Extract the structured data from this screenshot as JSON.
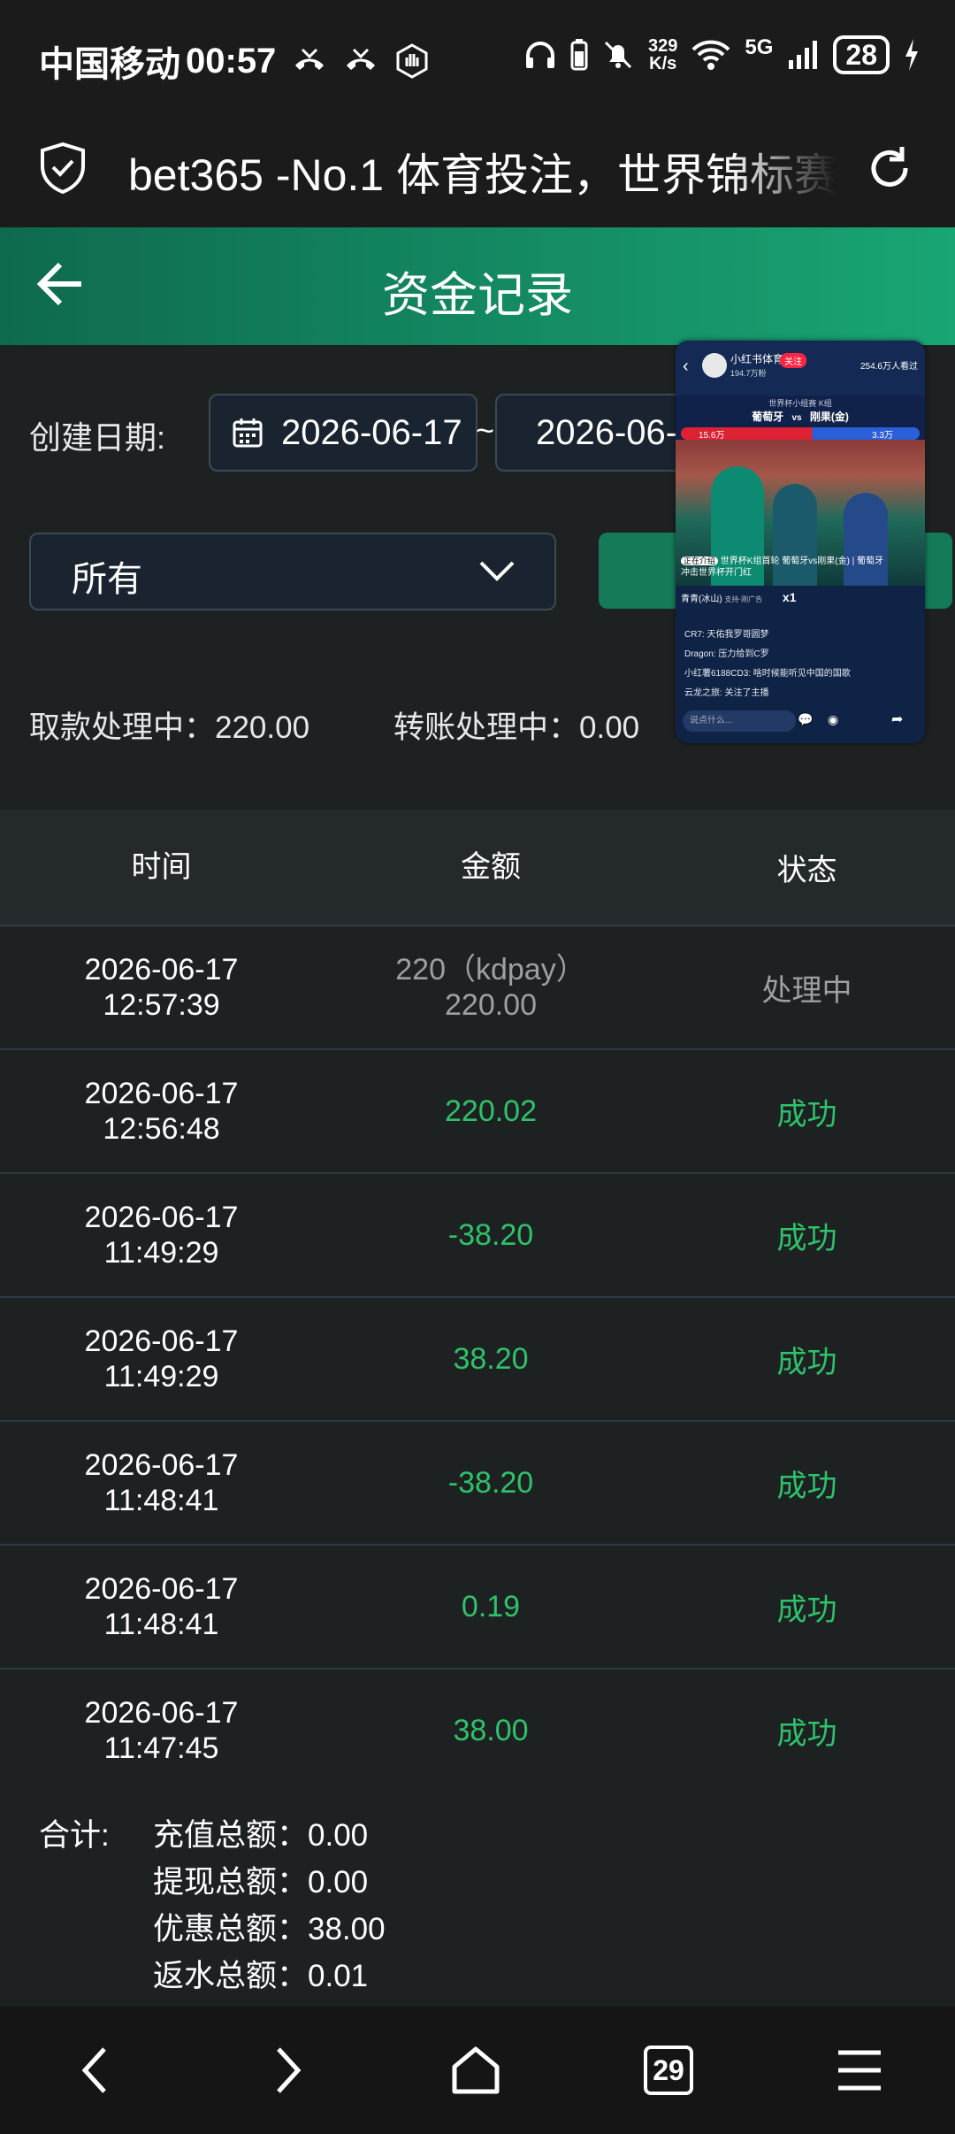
{
  "status_bar": {
    "carrier": "中国移动",
    "time": "00:57",
    "speed_top": "329",
    "speed_bottom": "K/s",
    "network": "5G",
    "battery": "28"
  },
  "browser": {
    "url_title": "bet365 -No.1 体育投注，世界锦标赛"
  },
  "header": {
    "title": "资金记录"
  },
  "filters": {
    "date_label": "创建日期:",
    "date_start": "2026-06-17",
    "date_separator": "~",
    "date_end": "2026-06-17",
    "type_select": "所有",
    "withdraw_pending": "取款处理中：220.00",
    "transfer_pending": "转账处理中：0.00"
  },
  "floating_video": {
    "channel": "小红书体育",
    "followers": "194.7万粉",
    "follow": "关注",
    "viewers": "254.6万人看过",
    "match_title": "世界杯小组赛 K组",
    "team_a": "葡萄牙",
    "vs": "vs",
    "team_b": "刚果(金)",
    "left_count": "15.6万",
    "right_count": "3.3万",
    "caption_tag": "正在介绍",
    "caption": "世界杯K组首轮 葡萄牙vs刚果(金) | 葡萄牙冲击世界杯开门红",
    "host": "青青(冰山)",
    "host_sub": "支持·刚广告",
    "gift_count": "x1",
    "comments": [
      "CR7: 天佑我罗哥圆梦",
      "Dragon: 压力给到C罗",
      "小红薯6188CD3: 啥时候能听见中国的国歌",
      "云龙之旅: 关注了主播"
    ],
    "input_placeholder": "说点什么..."
  },
  "table": {
    "headers": [
      "时间",
      "金额",
      "状态"
    ],
    "rows": [
      {
        "date": "2026-06-17",
        "time": "12:57:39",
        "amount": "220（kdpay）",
        "amount2": "220.00",
        "status": "处理中",
        "style": "grey"
      },
      {
        "date": "2026-06-17",
        "time": "12:56:48",
        "amount": "220.02",
        "amount2": "",
        "status": "成功",
        "style": "green"
      },
      {
        "date": "2026-06-17",
        "time": "11:49:29",
        "amount": "-38.20",
        "amount2": "",
        "status": "成功",
        "style": "green"
      },
      {
        "date": "2026-06-17",
        "time": "11:49:29",
        "amount": "38.20",
        "amount2": "",
        "status": "成功",
        "style": "green"
      },
      {
        "date": "2026-06-17",
        "time": "11:48:41",
        "amount": "-38.20",
        "amount2": "",
        "status": "成功",
        "style": "green"
      },
      {
        "date": "2026-06-17",
        "time": "11:48:41",
        "amount": "0.19",
        "amount2": "",
        "status": "成功",
        "style": "green"
      },
      {
        "date": "2026-06-17",
        "time": "11:47:45",
        "amount": "38.00",
        "amount2": "",
        "status": "成功",
        "style": "green"
      }
    ]
  },
  "totals": {
    "label": "合计:",
    "deposit": "充值总额：0.00",
    "withdraw": "提现总额：0.00",
    "bonus": "优惠总额：38.00",
    "rebate": "返水总额：0.01"
  },
  "navbar": {
    "tabs_count": "29"
  },
  "colors": {
    "header_gradient_start": "#0e6a4e",
    "header_gradient_end": "#19a574",
    "success_green": "#2ec26b",
    "pending_grey": "#9aa0a3"
  }
}
